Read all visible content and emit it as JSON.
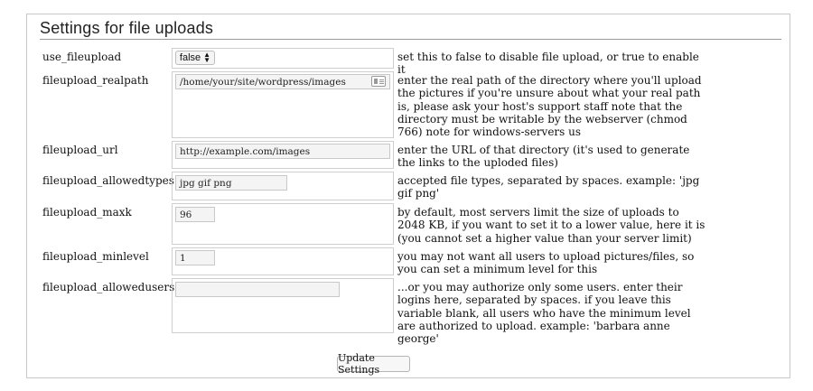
{
  "section": {
    "title": "Settings for file uploads"
  },
  "rows": [
    {
      "label": "use_fileupload",
      "description": "set this to false to disable file upload, or true to enable it"
    },
    {
      "label": "fileupload_realpath",
      "description": "enter the real path of the directory where you'll upload the pictures if you're unsure about what your real path is, please ask your host's support staff note that the directory must be writable by the webserver (chmod 766) note for windows-servers us"
    },
    {
      "label": "fileupload_url",
      "description": "enter the URL of that directory (it's used to generate the links to the uploded files)"
    },
    {
      "label": "fileupload_allowedtypes",
      "description": "accepted file types, separated by spaces. example: 'jpg gif png'"
    },
    {
      "label": "fileupload_maxk",
      "description": "by default, most servers limit the size of uploads to 2048 KB, if you want to set it to a lower value, here it is (you cannot set a higher value than your server limit)"
    },
    {
      "label": "fileupload_minlevel",
      "description": "you may not want all users to upload pictures/files, so you can set a minimum level for this"
    },
    {
      "label": "fileupload_allowedusers",
      "description": "...or you may authorize only some users. enter their logins here, separated by spaces. if you leave this variable blank, all users who have the minimum level are authorized to upload. example: 'barbara anne george'"
    }
  ],
  "fields": {
    "use_fileupload": {
      "selected": "false",
      "icon": "up-down-arrows-icon"
    },
    "fileupload_realpath": {
      "value": "/home/your/site/wordpress/images",
      "icon": "contact-card-icon"
    },
    "fileupload_url": {
      "value": "http://example.com/images"
    },
    "fileupload_allowedtypes": {
      "value": "jpg gif png"
    },
    "fileupload_maxk": {
      "value": "96"
    },
    "fileupload_minlevel": {
      "value": "1"
    },
    "fileupload_allowedusers": {
      "value": ""
    }
  },
  "actions": {
    "update_label": "Update Settings"
  }
}
